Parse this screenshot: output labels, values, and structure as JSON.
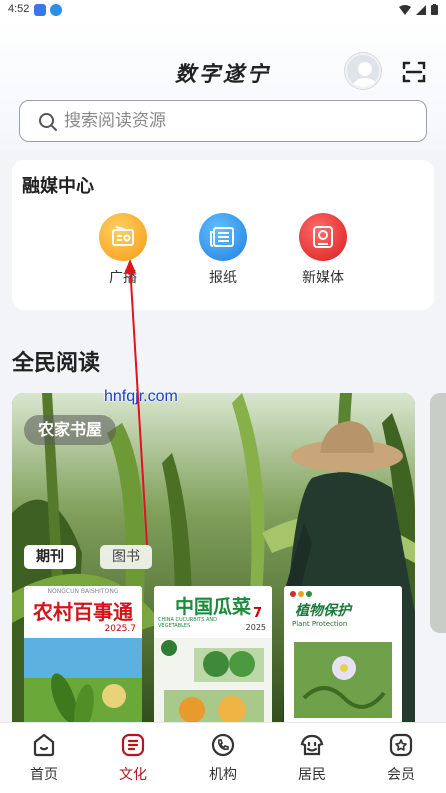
{
  "status_bar": {
    "time": "4:52"
  },
  "header": {
    "title": "数字遂宁",
    "search_placeholder": "搜索阅读资源"
  },
  "media_center": {
    "title": "融媒中心",
    "items": [
      {
        "label": "广播",
        "icon": "radio-icon",
        "color": "#f7a21b"
      },
      {
        "label": "报纸",
        "icon": "newspaper-icon",
        "color": "#2f8ee6"
      },
      {
        "label": "新媒体",
        "icon": "new-media-icon",
        "color": "#e63333"
      }
    ]
  },
  "reading": {
    "title": "全民阅读",
    "banner_label": "农家书屋",
    "tabs": [
      {
        "label": "期刊",
        "active": true
      },
      {
        "label": "图书",
        "active": false
      }
    ],
    "books": [
      {
        "title": "农村百事通",
        "pinyin": "NONGCUN BAISHITONG",
        "issue": "2025.7"
      },
      {
        "title": "中国瓜菜",
        "subtitle": "CHINA CUCURBITS AND VEGETABLES",
        "issue": "7",
        "year": "2025"
      },
      {
        "title": "植物保护",
        "subtitle": "Plant Protection"
      }
    ]
  },
  "watermark": "hnfqjr.com",
  "bottom_nav": [
    {
      "label": "首页",
      "icon": "home-icon",
      "active": false
    },
    {
      "label": "文化",
      "icon": "culture-icon",
      "active": true
    },
    {
      "label": "机构",
      "icon": "phone-icon",
      "active": false
    },
    {
      "label": "居民",
      "icon": "residents-icon",
      "active": false
    },
    {
      "label": "会员",
      "icon": "member-icon",
      "active": false
    }
  ],
  "colors": {
    "accent": "#b4161b",
    "annotation": "#e0141e"
  }
}
